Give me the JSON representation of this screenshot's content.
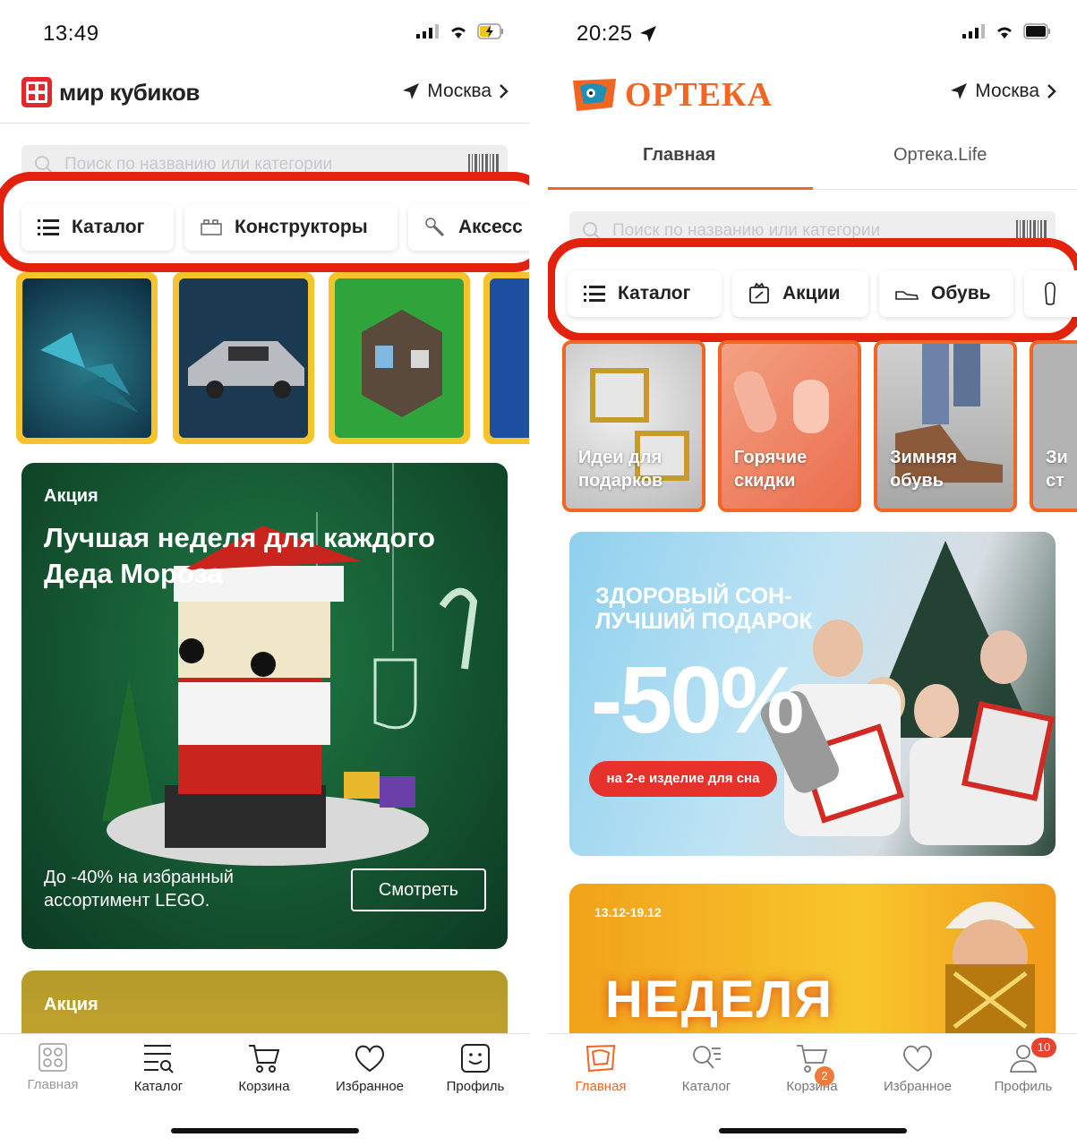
{
  "left": {
    "status_time": "13:49",
    "logo_text": "мир кубиков",
    "city": "Москва",
    "search_placeholder": "Поиск по названию или категории",
    "chips": [
      "Каталог",
      "Конструкторы",
      "Аксесс"
    ],
    "banner": {
      "tag": "Акция",
      "title": "Лучшая неделя для каждого Деда Мороза",
      "subtitle": "До -40% на избранный ассортимент LEGO.",
      "button": "Смотреть"
    },
    "banner2_tag": "Акция",
    "tabs": [
      "Главная",
      "Каталог",
      "Корзина",
      "Избранное",
      "Профиль"
    ]
  },
  "right": {
    "status_time": "20:25",
    "logo_text": "ОРТЕКА",
    "city": "Москва",
    "segments": [
      "Главная",
      "Ортека.Life"
    ],
    "search_placeholder": "Поиск по названию или категории",
    "chips": [
      "Каталог",
      "Акции",
      "Обувь"
    ],
    "thumbs": [
      "Идеи для подарков",
      "Горячие скидки",
      "Зимняя обувь",
      "Зи ст"
    ],
    "banner": {
      "headline": "ЗДОРОВЫЙ СОН- ЛУЧШИЙ ПОДАРОК",
      "discount": "-50%",
      "pill": "на 2-е изделие для сна"
    },
    "banner2": {
      "dates": "13.12-19.12",
      "headline": "НЕДЕЛЯ"
    },
    "tabs": [
      "Главная",
      "Каталог",
      "Корзина",
      "Избранное",
      "Профиль"
    ],
    "cart_badge": "2",
    "profile_badge": "10"
  },
  "colors": {
    "highlight_red": "#e3220d",
    "mirkubikov_red": "#e3272d",
    "orteka_orange": "#f26522",
    "thumb_border_yellow": "#f5c32c"
  }
}
